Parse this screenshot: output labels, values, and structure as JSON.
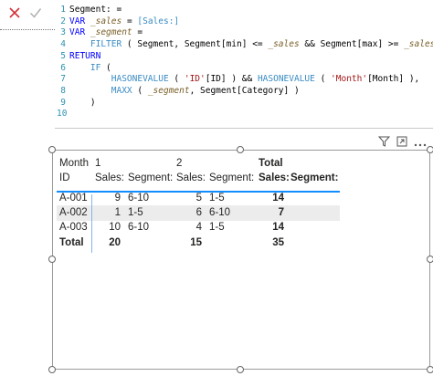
{
  "toolbar": {
    "cancel_icon": "close-icon",
    "commit_icon": "check-icon",
    "cancel_color": "#d13438"
  },
  "editor": {
    "lines": [
      {
        "no": "1",
        "segments": [
          {
            "t": "Segment: =",
            "c": ""
          }
        ]
      },
      {
        "no": "2",
        "segments": [
          {
            "t": "VAR ",
            "c": "kw"
          },
          {
            "t": "_sales",
            "c": "var it"
          },
          {
            "t": " = ",
            "c": ""
          },
          {
            "t": "[Sales:]",
            "c": "fn"
          }
        ]
      },
      {
        "no": "3",
        "segments": [
          {
            "t": "VAR ",
            "c": "kw"
          },
          {
            "t": "_segment",
            "c": "var it"
          },
          {
            "t": " =",
            "c": ""
          }
        ]
      },
      {
        "no": "4",
        "segments": [
          {
            "t": "    FILTER",
            "c": "fn"
          },
          {
            "t": " ( Segment, Segment[min] <= ",
            "c": ""
          },
          {
            "t": "_sales",
            "c": "var it"
          },
          {
            "t": " && Segment[max] >= ",
            "c": ""
          },
          {
            "t": "_sales",
            "c": "var it"
          },
          {
            "t": " )",
            "c": ""
          }
        ]
      },
      {
        "no": "5",
        "segments": [
          {
            "t": "RETURN",
            "c": "kw"
          }
        ]
      },
      {
        "no": "6",
        "segments": [
          {
            "t": "    IF",
            "c": "fn"
          },
          {
            "t": " (",
            "c": ""
          }
        ]
      },
      {
        "no": "7",
        "segments": [
          {
            "t": "        HASONEVALUE",
            "c": "fn"
          },
          {
            "t": " ( ",
            "c": ""
          },
          {
            "t": "'ID'",
            "c": "str"
          },
          {
            "t": "[ID] ) && ",
            "c": ""
          },
          {
            "t": "HASONEVALUE",
            "c": "fn"
          },
          {
            "t": " ( ",
            "c": ""
          },
          {
            "t": "'Month'",
            "c": "str"
          },
          {
            "t": "[Month] ),",
            "c": ""
          }
        ]
      },
      {
        "no": "8",
        "segments": [
          {
            "t": "        MAXX",
            "c": "fn"
          },
          {
            "t": " ( ",
            "c": ""
          },
          {
            "t": "_segment",
            "c": "var it"
          },
          {
            "t": ", Segment[Category] )",
            "c": ""
          }
        ]
      },
      {
        "no": "9",
        "segments": [
          {
            "t": "    )",
            "c": ""
          }
        ]
      },
      {
        "no": "10",
        "segments": [
          {
            "t": "",
            "c": ""
          }
        ]
      }
    ]
  },
  "visual_header": {
    "filter_icon": "filter-icon",
    "focus_icon": "focus-mode-icon",
    "more_icon": "more-options-icon"
  },
  "matrix": {
    "header_row1": {
      "corner": "Month",
      "month1": "1",
      "month2": "2",
      "total": "Total"
    },
    "header_row2": {
      "corner": "ID",
      "sales1": "Sales:",
      "segment1": "Segment:",
      "sales2": "Sales:",
      "segment2": "Segment:",
      "total_sales": "Sales:",
      "total_segment": "Segment:"
    },
    "rows": [
      {
        "id": "A-001",
        "sales1": "9",
        "segment1": "6-10",
        "sales2": "5",
        "segment2": "1-5",
        "total_sales": "14",
        "total_segment": ""
      },
      {
        "id": "A-002",
        "sales1": "1",
        "segment1": "1-5",
        "sales2": "6",
        "segment2": "6-10",
        "total_sales": "7",
        "total_segment": ""
      },
      {
        "id": "A-003",
        "sales1": "10",
        "segment1": "6-10",
        "sales2": "4",
        "segment2": "1-5",
        "total_sales": "14",
        "total_segment": ""
      }
    ],
    "total_row": {
      "label": "Total",
      "sales1": "20",
      "segment1": "",
      "sales2": "15",
      "segment2": "",
      "total_sales": "35",
      "total_segment": ""
    },
    "accent_color": "#118dff",
    "band_color": "#ececec"
  }
}
